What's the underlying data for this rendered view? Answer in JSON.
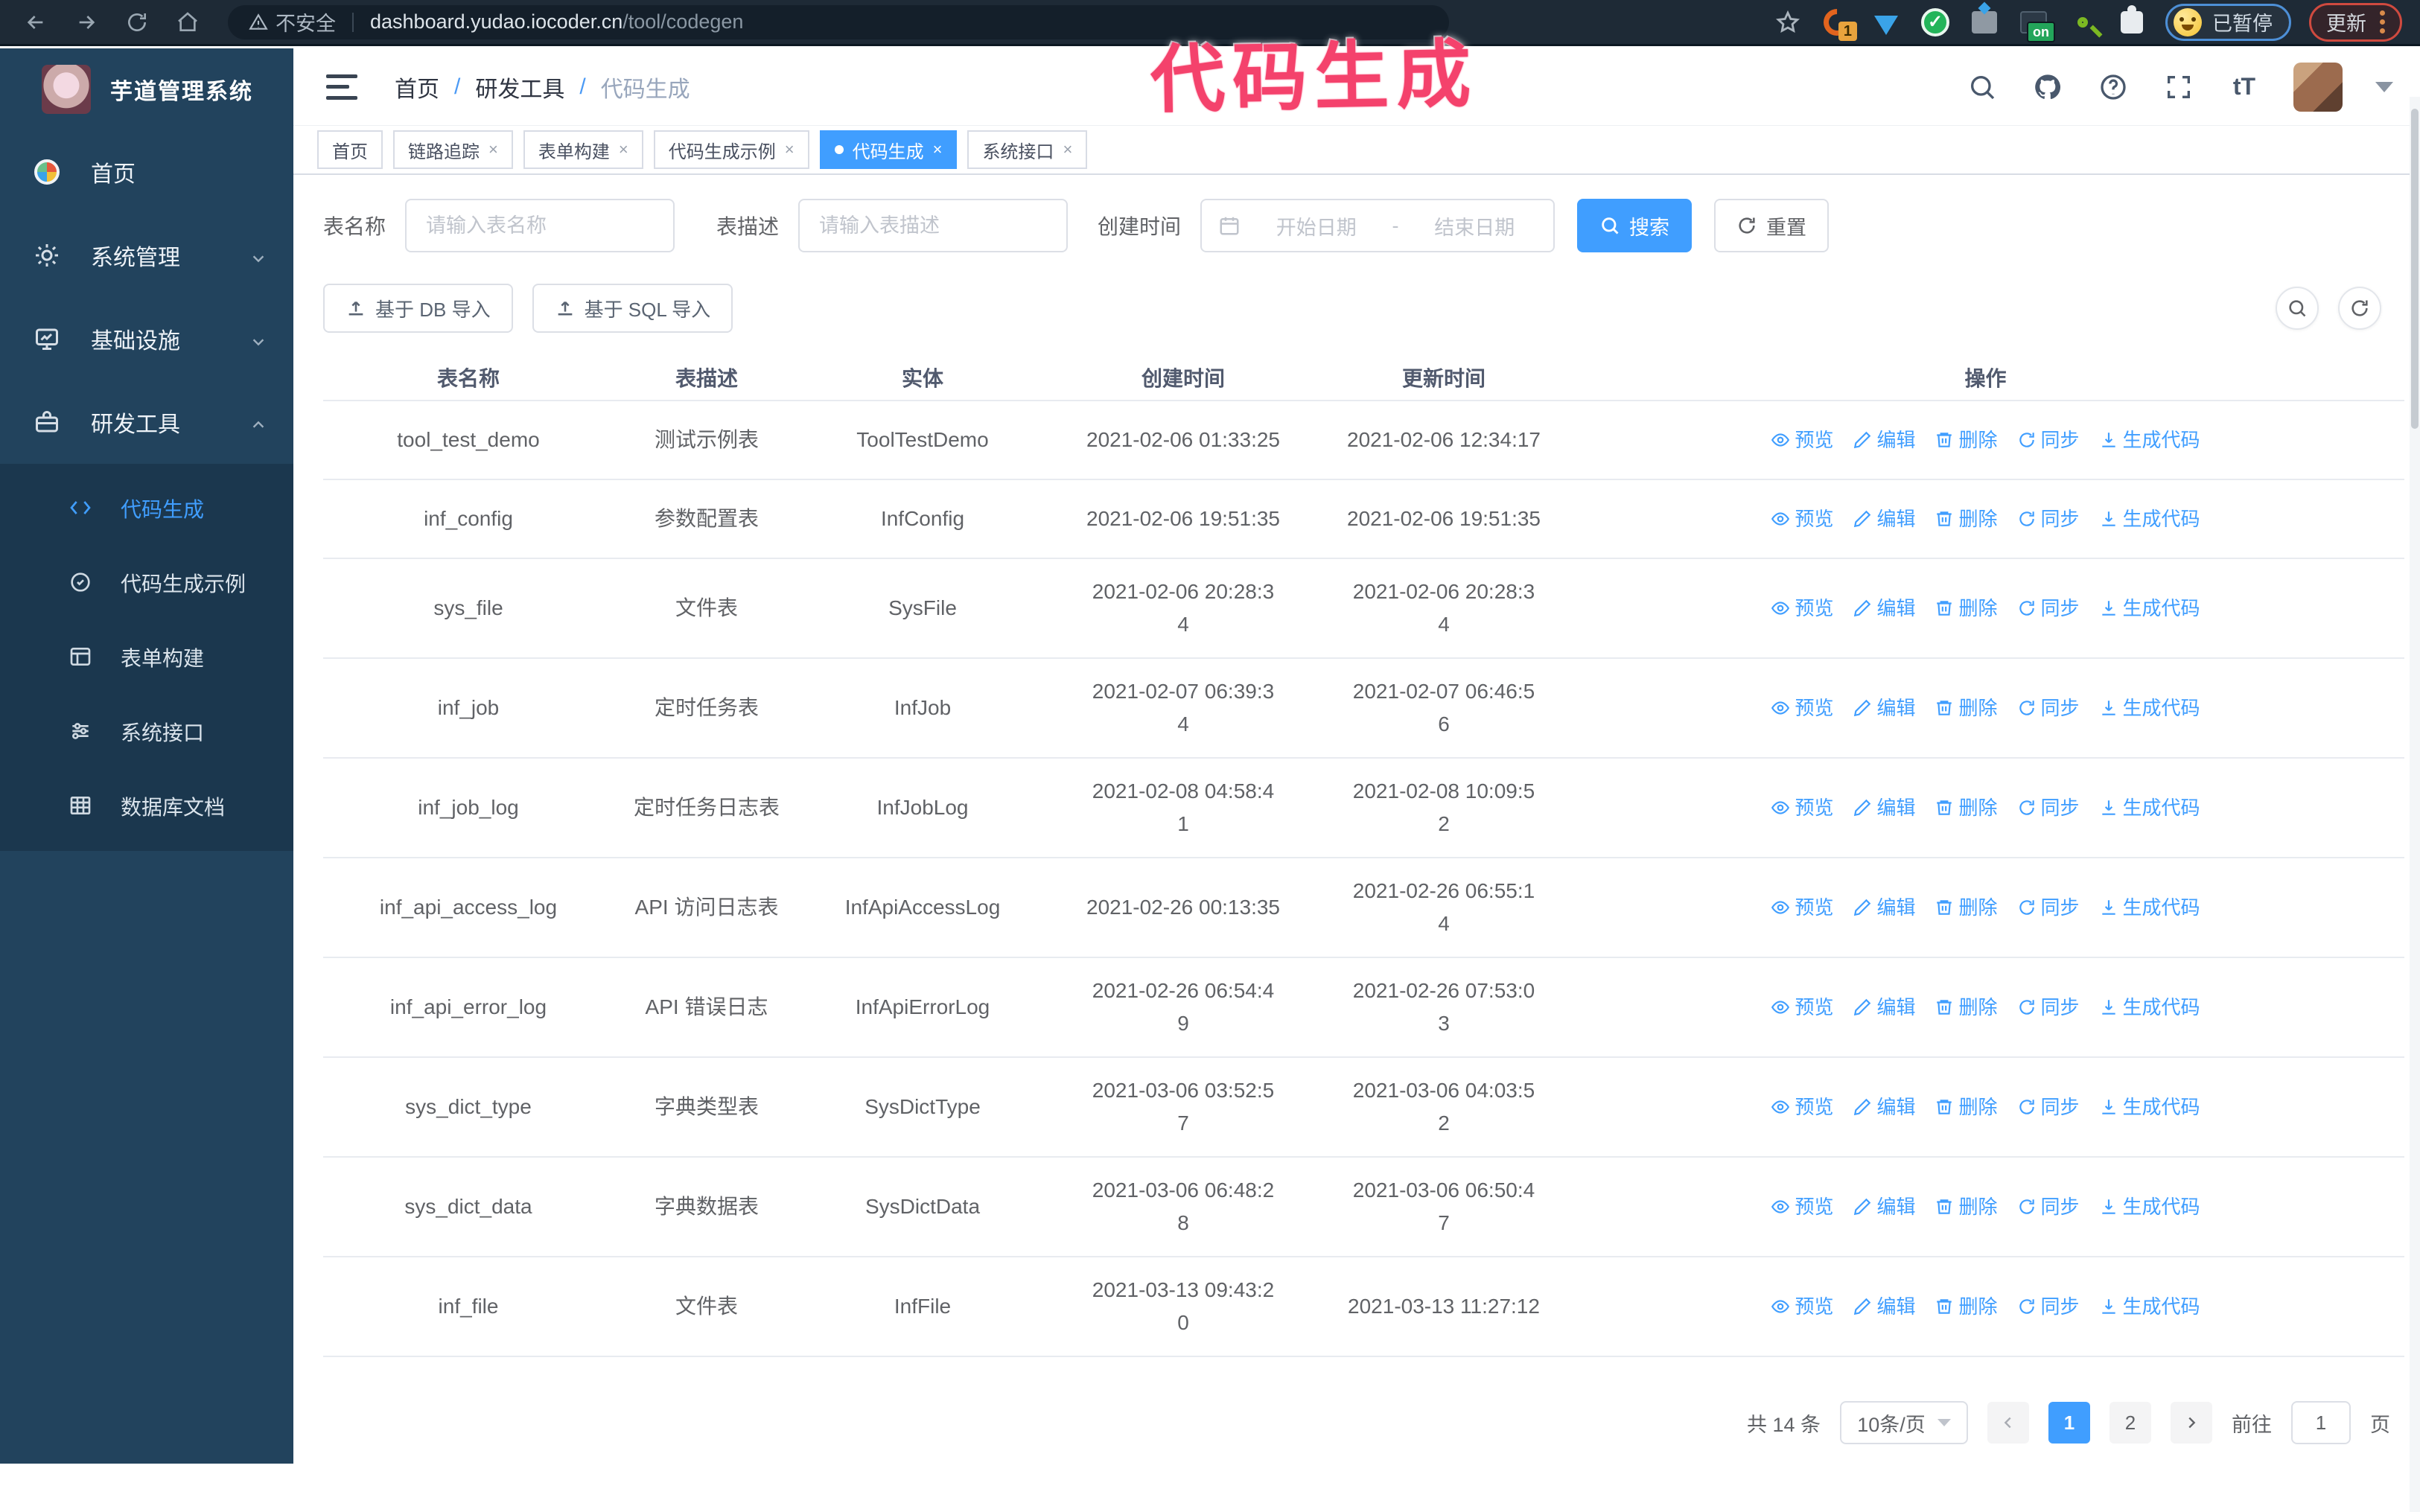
{
  "annotation": {
    "text": "代码生成",
    "color": "#f4426c"
  },
  "browser": {
    "security_label": "不安全",
    "url_domain": "dashboard.yudao.iocoder.cn",
    "url_path": "/tool/codegen",
    "extension_badge": "1",
    "extension_on_badge": "on",
    "paused_badge": "已暂停",
    "update_button": "更新"
  },
  "sidebar": {
    "title": "芋道管理系统",
    "items": [
      {
        "label": "首页",
        "icon": "dashboard-icon"
      },
      {
        "label": "系统管理",
        "icon": "gear-icon"
      },
      {
        "label": "基础设施",
        "icon": "monitor-icon"
      },
      {
        "label": "研发工具",
        "icon": "toolbox-icon"
      }
    ],
    "subitems": [
      {
        "label": "代码生成",
        "icon": "code-icon",
        "active": true
      },
      {
        "label": "代码生成示例",
        "icon": "badge-check-icon"
      },
      {
        "label": "表单构建",
        "icon": "form-icon"
      },
      {
        "label": "系统接口",
        "icon": "sliders-icon"
      },
      {
        "label": "数据库文档",
        "icon": "table-grid-icon"
      }
    ]
  },
  "header": {
    "breadcrumb": [
      "首页",
      "研发工具",
      "代码生成"
    ],
    "separator": "/",
    "font_size_icon": "tT"
  },
  "tabs": [
    {
      "label": "首页"
    },
    {
      "label": "链路追踪"
    },
    {
      "label": "表单构建"
    },
    {
      "label": "代码生成示例"
    },
    {
      "label": "代码生成"
    },
    {
      "label": "系统接口"
    }
  ],
  "search_form": {
    "table_name_label": "表名称",
    "table_name_placeholder": "请输入表名称",
    "table_desc_label": "表描述",
    "table_desc_placeholder": "请输入表描述",
    "create_time_label": "创建时间",
    "date_start_placeholder": "开始日期",
    "date_separator": "-",
    "date_end_placeholder": "结束日期",
    "search_button": "搜索",
    "reset_button": "重置"
  },
  "toolbar": {
    "import_db_button": "基于 DB 导入",
    "import_sql_button": "基于 SQL 导入"
  },
  "table": {
    "columns": [
      "表名称",
      "表描述",
      "实体",
      "创建时间",
      "更新时间",
      "操作"
    ],
    "actions": [
      "预览",
      "编辑",
      "删除",
      "同步",
      "生成代码"
    ],
    "rows": [
      {
        "name": "tool_test_demo",
        "desc": "测试示例表",
        "entity": "ToolTestDemo",
        "created": "2021-02-06 01:33:25",
        "updated": "2021-02-06 12:34:17"
      },
      {
        "name": "inf_config",
        "desc": "参数配置表",
        "entity": "InfConfig",
        "created": "2021-02-06 19:51:35",
        "updated": "2021-02-06 19:51:35"
      },
      {
        "name": "sys_file",
        "desc": "文件表",
        "entity": "SysFile",
        "created": "2021-02-06 20:28:3\n4",
        "updated": "2021-02-06 20:28:3\n4"
      },
      {
        "name": "inf_job",
        "desc": "定时任务表",
        "entity": "InfJob",
        "created": "2021-02-07 06:39:3\n4",
        "updated": "2021-02-07 06:46:5\n6"
      },
      {
        "name": "inf_job_log",
        "desc": "定时任务日志表",
        "entity": "InfJobLog",
        "created": "2021-02-08 04:58:4\n1",
        "updated": "2021-02-08 10:09:5\n2"
      },
      {
        "name": "inf_api_access_log",
        "desc": "API 访问日志表",
        "entity": "InfApiAccessLog",
        "created": "2021-02-26 00:13:35",
        "updated": "2021-02-26 06:55:1\n4"
      },
      {
        "name": "inf_api_error_log",
        "desc": "API 错误日志",
        "entity": "InfApiErrorLog",
        "created": "2021-02-26 06:54:4\n9",
        "updated": "2021-02-26 07:53:0\n3"
      },
      {
        "name": "sys_dict_type",
        "desc": "字典类型表",
        "entity": "SysDictType",
        "created": "2021-03-06 03:52:5\n7",
        "updated": "2021-03-06 04:03:5\n2"
      },
      {
        "name": "sys_dict_data",
        "desc": "字典数据表",
        "entity": "SysDictData",
        "created": "2021-03-06 06:48:2\n8",
        "updated": "2021-03-06 06:50:4\n7"
      },
      {
        "name": "inf_file",
        "desc": "文件表",
        "entity": "InfFile",
        "created": "2021-03-13 09:43:2\n0",
        "updated": "2021-03-13 11:27:12"
      }
    ]
  },
  "pagination": {
    "total": "共 14 条",
    "page_size": "10条/页",
    "pages": [
      "1",
      "2"
    ],
    "active_page": "1",
    "goto_label": "前往",
    "goto_value": "1",
    "goto_suffix": "页"
  },
  "colors": {
    "accent_blue": "#409eff",
    "sidebar_bg": "#22435d",
    "submenu_bg": "#1b374e",
    "chrome_bg": "#1e2a36",
    "annotation_pink": "#f4426c"
  }
}
